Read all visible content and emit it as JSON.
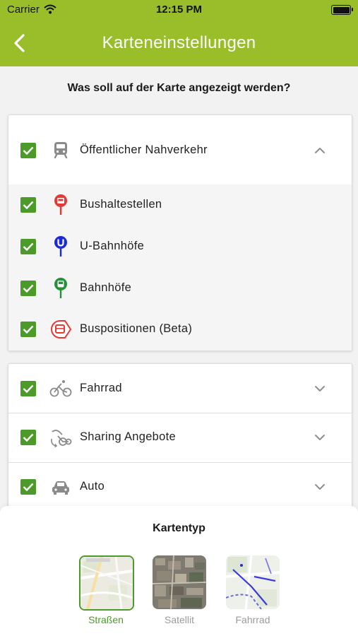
{
  "status_bar": {
    "carrier": "Carrier",
    "time": "12:15 PM"
  },
  "nav": {
    "title": "Karteneinstellungen",
    "back_icon": "chevron-left-icon"
  },
  "question": "Was soll auf der Karte angezeigt werden?",
  "transit_section": {
    "label": "Öffentlicher Nahverkehr",
    "checked": true,
    "expanded": true,
    "items": [
      {
        "label": "Bushaltestellen",
        "checked": true,
        "icon": "bus-stop-pin-icon",
        "color": "#e53935"
      },
      {
        "label": "U-Bahnhöfe",
        "checked": true,
        "icon": "subway-pin-icon",
        "color": "#1a2bd6"
      },
      {
        "label": "Bahnhöfe",
        "checked": true,
        "icon": "train-station-pin-icon",
        "color": "#23913a"
      },
      {
        "label": "Buspositionen (Beta)",
        "checked": true,
        "icon": "bus-position-icon",
        "color": "#e53935"
      }
    ]
  },
  "sections": [
    {
      "label": "Fahrrad",
      "checked": true,
      "icon": "bicycle-icon"
    },
    {
      "label": "Sharing Angebote",
      "checked": true,
      "icon": "sharing-bike-icon"
    },
    {
      "label": "Auto",
      "checked": true,
      "icon": "car-icon"
    }
  ],
  "map_type": {
    "title": "Kartentyp",
    "options": [
      {
        "label": "Straßen",
        "selected": true
      },
      {
        "label": "Satellit",
        "selected": false
      },
      {
        "label": "Fahrrad",
        "selected": false
      }
    ]
  },
  "colors": {
    "accent": "#9abd2a",
    "check": "#4c9a2a"
  }
}
